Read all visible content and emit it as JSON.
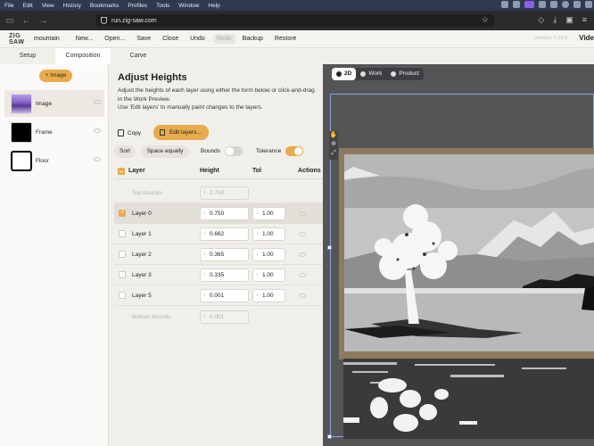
{
  "menubar": {
    "items": [
      "File",
      "Edit",
      "View",
      "History",
      "Bookmarks",
      "Profiles",
      "Tools",
      "Window",
      "Help"
    ]
  },
  "browser": {
    "url": "run.zig-saw.com"
  },
  "toolbar": {
    "logo_line1": "ZIG",
    "logo_line2": "SAW",
    "project": "mountain",
    "buttons": [
      "New...",
      "Open...",
      "Save",
      "Close",
      "Undo",
      "Redo",
      "Backup",
      "Restore"
    ],
    "version": "Version: 1.24.3",
    "cut_label": "Vide"
  },
  "tabs": [
    "Setup",
    "Composition",
    "Carve"
  ],
  "composition": {
    "add_image": "+ Image",
    "items": [
      {
        "label": "Image"
      },
      {
        "label": "Frame"
      },
      {
        "label": "Floor"
      }
    ]
  },
  "adjust": {
    "title": "Adjust Heights",
    "desc1": "Adjust the heights of each layer using either the form below or click-and-drag in the Work Preview.",
    "desc2": "Use 'Edit layers' to manually paint changes to the layers.",
    "copy": "Copy",
    "edit_layers": "Edit layers...",
    "sort": "Sort",
    "space_equally": "Space equally",
    "bounds": "Bounds",
    "tolerance": "Tolerance",
    "headers": {
      "layer": "Layer",
      "height": "Height",
      "tol": "Tol",
      "actions": "Actions"
    },
    "top_bounds": {
      "name": "Top bounds",
      "height": "0.750"
    },
    "rows": [
      {
        "name": "Layer 0",
        "height": "0.750",
        "tol": "1.00"
      },
      {
        "name": "Layer 1",
        "height": "0.662",
        "tol": "1.00"
      },
      {
        "name": "Layer 2",
        "height": "0.365",
        "tol": "1.00"
      },
      {
        "name": "Layer 3",
        "height": "0.335",
        "tol": "1.00"
      },
      {
        "name": "Layer 5",
        "height": "0.001",
        "tol": "1.00"
      }
    ],
    "bottom_bounds": {
      "name": "Bottom bounds",
      "height": "0.001"
    }
  },
  "preview": {
    "tabs": [
      "2D",
      "Work",
      "Product"
    ]
  }
}
